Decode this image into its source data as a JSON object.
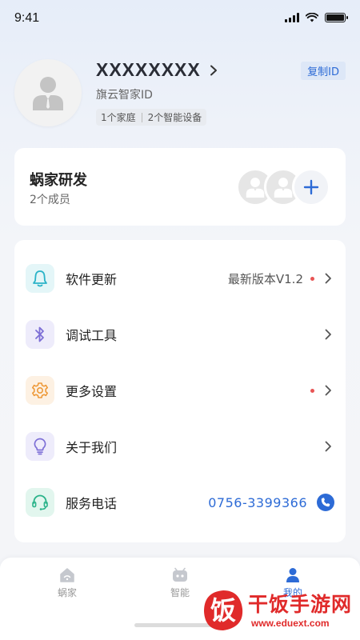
{
  "status_bar": {
    "time": "9:41"
  },
  "profile": {
    "username": "XXXXXXXX",
    "id_label": "旗云智家ID",
    "tags": [
      "1个家庭",
      "2个智能设备"
    ],
    "copy_id_label": "复制ID"
  },
  "family": {
    "name": "蜗家研发",
    "member_count": "2个成员"
  },
  "menu": {
    "items": [
      {
        "label": "软件更新",
        "value": "最新版本V1.2",
        "icon": "bell-icon",
        "color": "#2bb3c8",
        "bg": "#e4f6f8",
        "dot": true
      },
      {
        "label": "调试工具",
        "value": "",
        "icon": "bluetooth-icon",
        "color": "#7d6fd6",
        "bg": "#eeecfb",
        "dot": false
      },
      {
        "label": "更多设置",
        "value": "",
        "icon": "gear-icon",
        "color": "#ee9a3a",
        "bg": "#fdf1e3",
        "dot": true
      },
      {
        "label": "关于我们",
        "value": "",
        "icon": "lightbulb-icon",
        "color": "#7d6fd6",
        "bg": "#eeecfb",
        "dot": false
      },
      {
        "label": "服务电话",
        "value": "0756-3399366",
        "icon": "headset-icon",
        "color": "#2bb38a",
        "bg": "#e2f6ee",
        "dot": false
      }
    ]
  },
  "tabbar": {
    "tabs": [
      {
        "label": "蜗家",
        "icon": "home-icon",
        "active": false
      },
      {
        "label": "智能",
        "icon": "robot-icon",
        "active": false
      },
      {
        "label": "我的",
        "icon": "person-icon",
        "active": true
      }
    ]
  },
  "watermark": {
    "title": "干饭手游网",
    "url": "www.eduext.com",
    "glyph": "饭"
  },
  "colors": {
    "accent": "#2d6bd6",
    "dot_red": "#e85454",
    "watermark_red": "#e02a2a"
  }
}
